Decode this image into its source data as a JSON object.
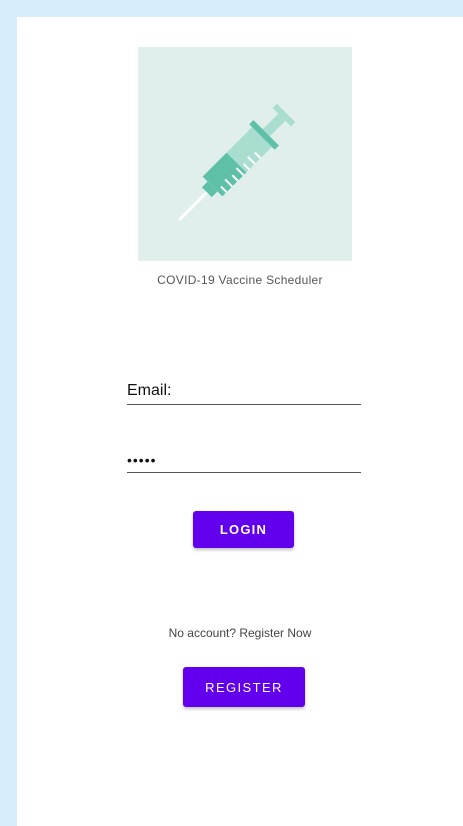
{
  "app": {
    "title": "COVID-19 Vaccine Scheduler",
    "logo_icon": "syringe-icon"
  },
  "login_form": {
    "email_placeholder": "Email:",
    "email_value": "",
    "password_value": "•••••",
    "login_label": "LOGIN"
  },
  "register": {
    "prompt": "No account? Register Now",
    "register_label": "REGISTER"
  },
  "colors": {
    "page_background": "#d6edfb",
    "logo_background": "#e0efec",
    "syringe_primary": "#5fc0a8",
    "syringe_secondary": "#a9ddd0",
    "button_primary": "#6200ee"
  }
}
